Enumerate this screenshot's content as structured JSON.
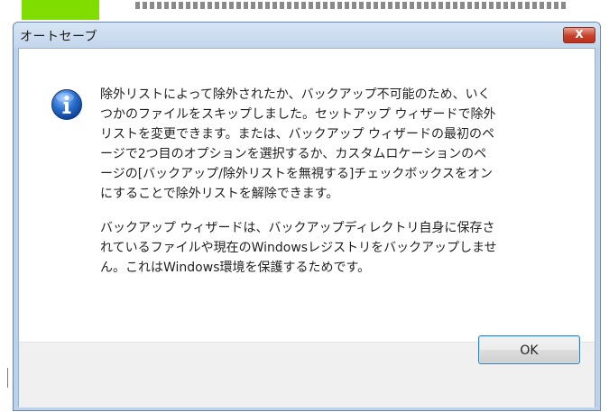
{
  "dialog": {
    "title": "オートセーブ",
    "close_glyph": "X",
    "icon": "info-icon",
    "message_paragraphs": [
      "除外リストによって除外されたか、バックアップ不可能のため、いく\nつかのファイルをスキップしました。セットアップ ウィザードで除外\nリストを変更できます。または、バックアップ ウィザードの最初のペ\nージで2つ目のオプションを選択するか、カスタムロケーションのペ\nージの[バックアップ/除外リストを無視する]チェックボックスをオン\nにすることで除外リストを解除できます。",
      "バックアップ ウィザードは、バックアップディレクトリ自身に保存さ\nれているファイルや現在のWindowsレジストリをバックアップしませ\nん。これはWindows環境を保護するためです。"
    ],
    "ok_label": "OK"
  },
  "colors": {
    "title_bar": "#c3d6ec",
    "close_button": "#c8402a",
    "ok_border": "#3c7fb1",
    "info_icon": "#2a6fd1",
    "background_green": "#7fdd00"
  }
}
